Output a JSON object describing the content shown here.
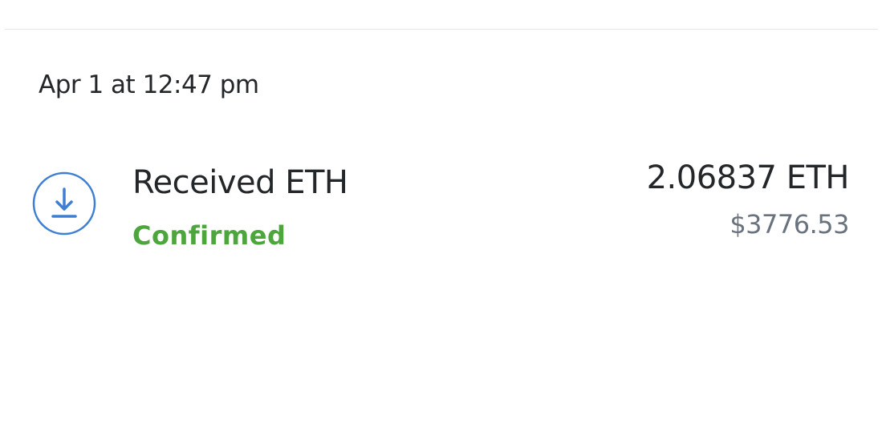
{
  "activity": {
    "date": "Apr 1 at 12:47 pm",
    "transaction": {
      "icon": "receive-icon",
      "title": "Received ETH",
      "status": "Confirmed",
      "amount": "2.06837 ETH",
      "fiat": "$3776.53"
    }
  },
  "colors": {
    "icon_blue": "#3f7fd2",
    "status_green": "#4ca63b",
    "text_primary": "#24272a",
    "text_secondary": "#6a737d",
    "divider": "#e4e6e8"
  }
}
